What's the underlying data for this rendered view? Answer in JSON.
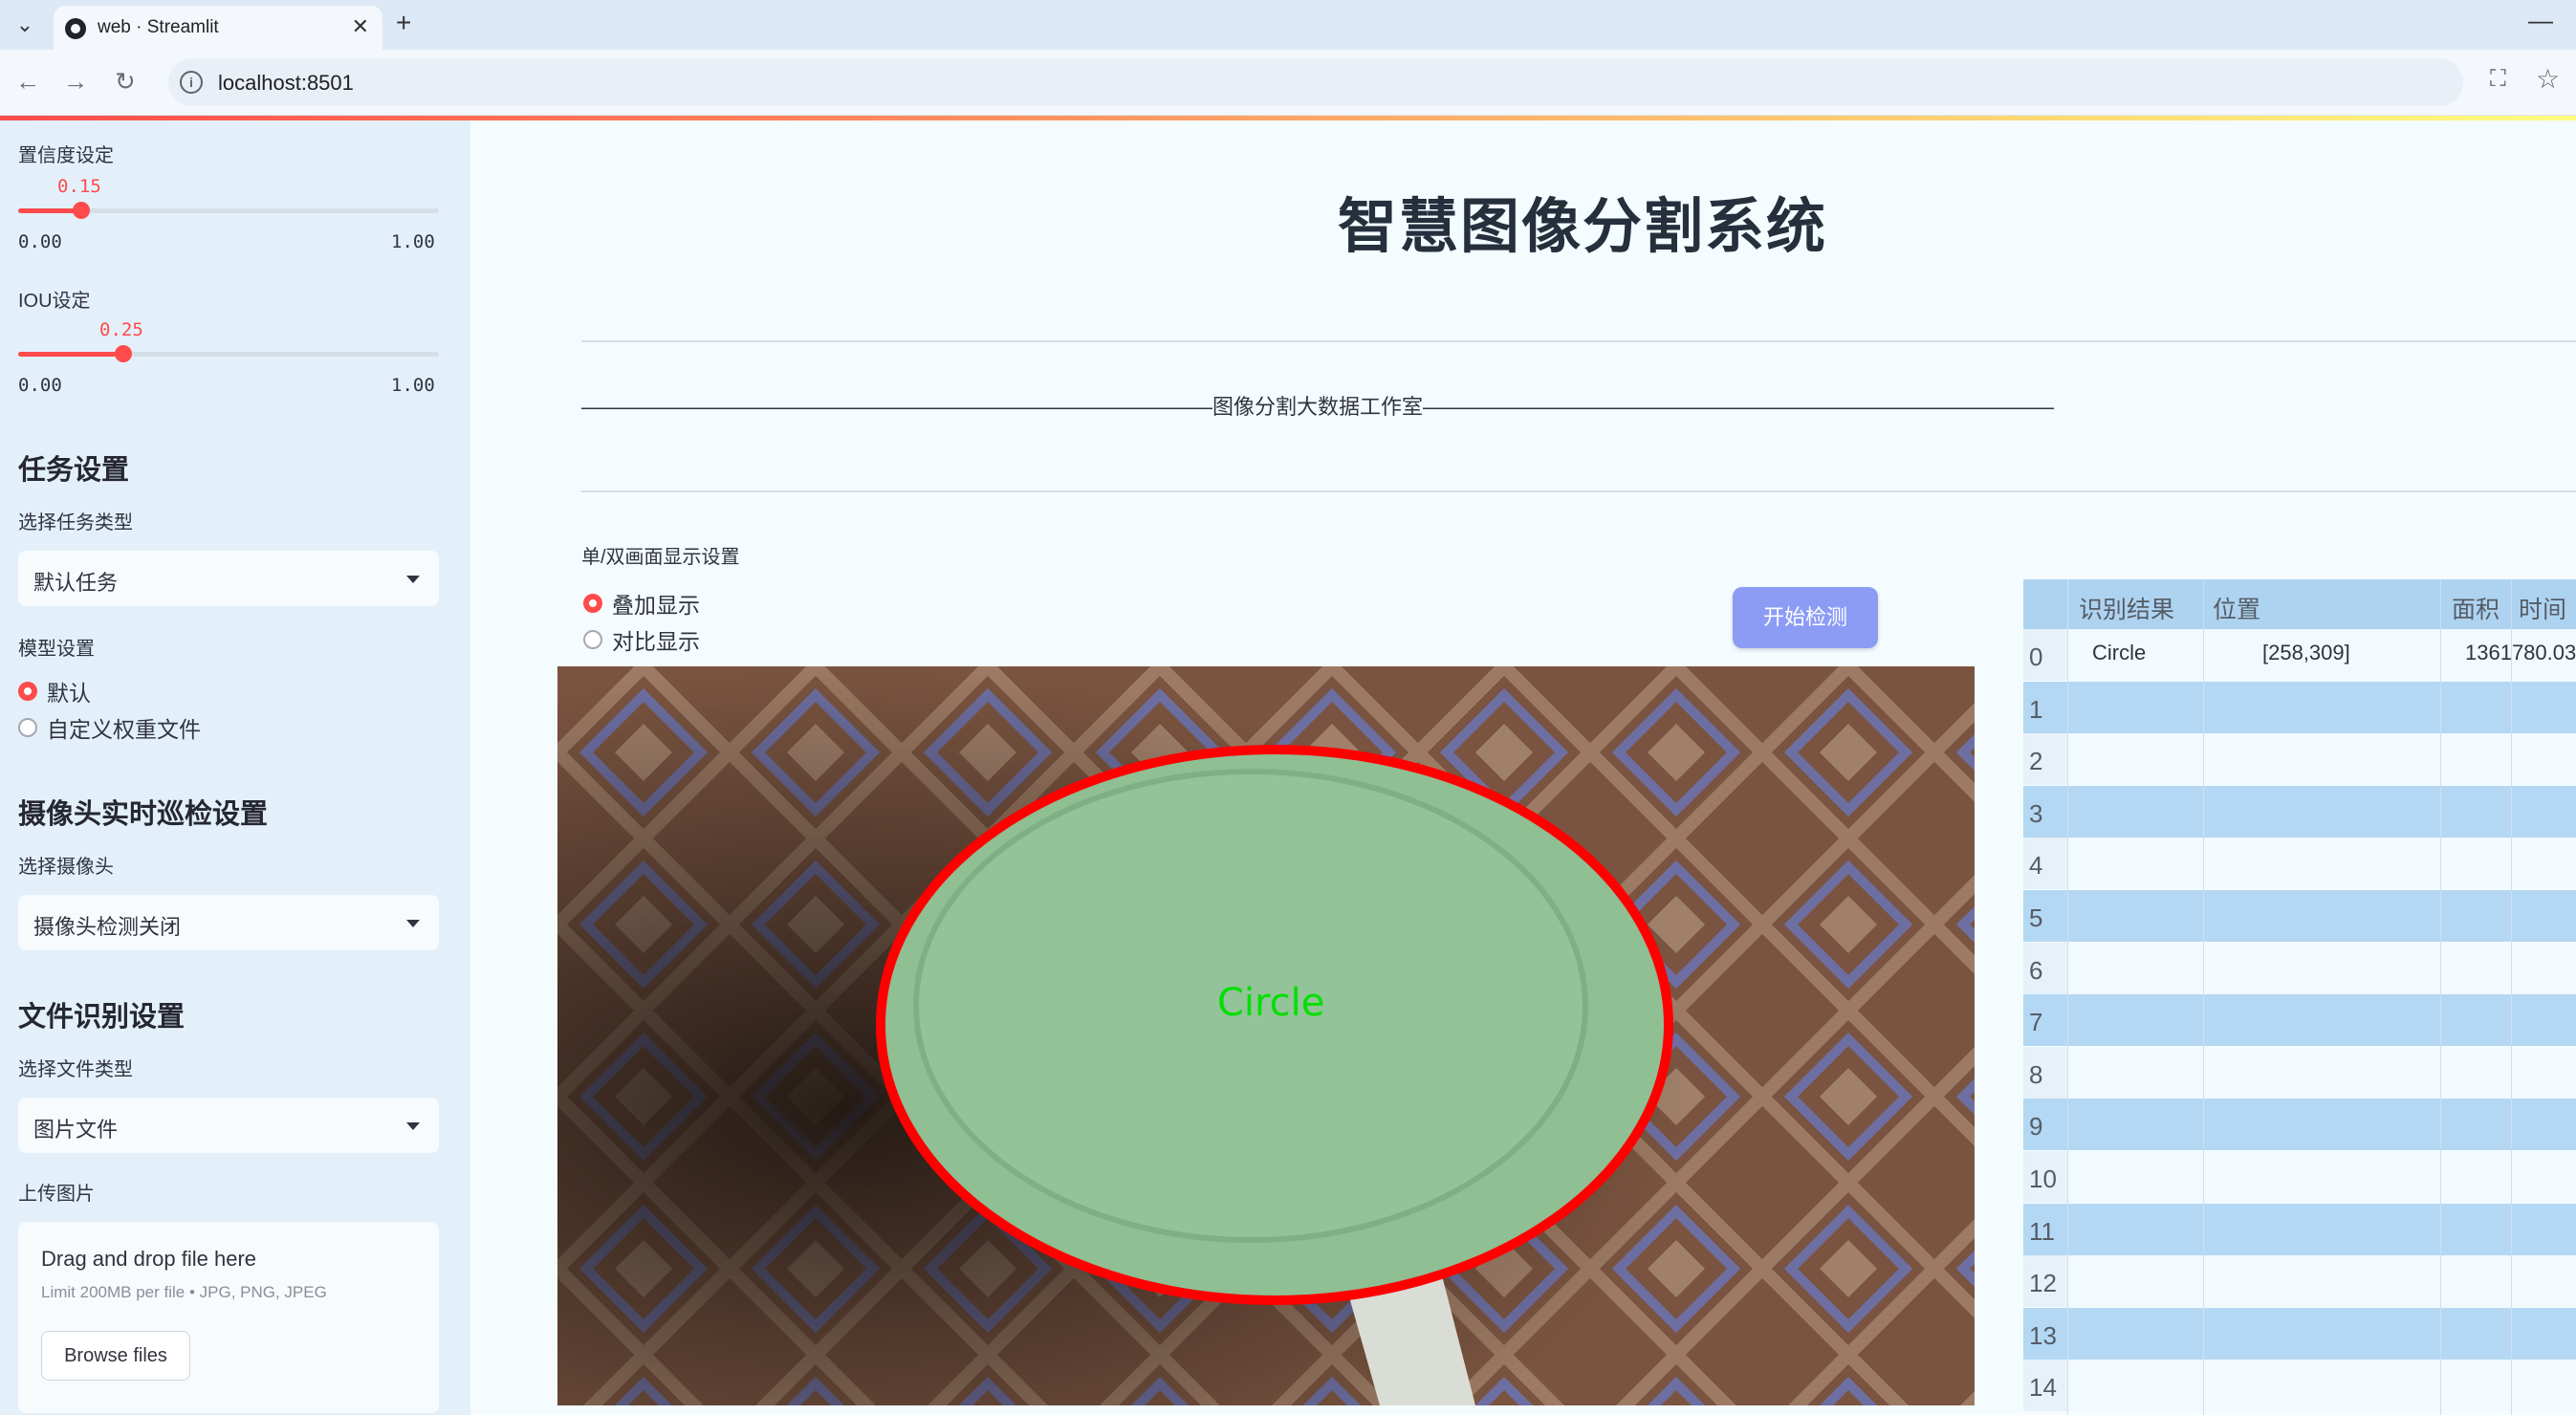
{
  "browser": {
    "tab_title": "web · Streamlit",
    "url": "localhost:8501"
  },
  "sidebar": {
    "confidence": {
      "label": "置信度设定",
      "value": "0.15",
      "value_fraction": 0.15,
      "min": "0.00",
      "max": "1.00"
    },
    "iou": {
      "label": "IOU设定",
      "value": "0.25",
      "value_fraction": 0.25,
      "min": "0.00",
      "max": "1.00"
    },
    "task_section": {
      "heading": "任务设置",
      "select_label": "选择任务类型",
      "select_value": "默认任务"
    },
    "model_section": {
      "label": "模型设置",
      "options": [
        "默认",
        "自定义权重文件"
      ],
      "selected": "默认"
    },
    "camera_section": {
      "heading": "摄像头实时巡检设置",
      "select_label": "选择摄像头",
      "select_value": "摄像头检测关闭"
    },
    "file_section": {
      "heading": "文件识别设置",
      "select_label": "选择文件类型",
      "select_value": "图片文件",
      "upload_label": "上传图片"
    },
    "uploader": {
      "title": "Drag and drop file here",
      "limit": "Limit 200MB per file • JPG, PNG, JPEG",
      "button": "Browse files"
    }
  },
  "main": {
    "title": "智慧图像分割系统",
    "subtitle": "——————————————————————————————图像分割大数据工作室——————————————————————————————",
    "display_label": "单/双画面显示设置",
    "display_options": [
      "叠加显示",
      "对比显示"
    ],
    "display_selected": "叠加显示",
    "start_button": "开始检测",
    "detection_label": "Circle"
  },
  "results_table": {
    "columns": [
      "识别结果",
      "位置",
      "面积",
      "时间"
    ],
    "rows": [
      {
        "index": "0",
        "result": "Circle",
        "position": "[258,309]",
        "area": "1361780.03",
        "time": ""
      },
      {
        "index": "1"
      },
      {
        "index": "2"
      },
      {
        "index": "3"
      },
      {
        "index": "4"
      },
      {
        "index": "5"
      },
      {
        "index": "6"
      },
      {
        "index": "7"
      },
      {
        "index": "8"
      },
      {
        "index": "9"
      },
      {
        "index": "10"
      },
      {
        "index": "11"
      },
      {
        "index": "12"
      },
      {
        "index": "13"
      },
      {
        "index": "14"
      }
    ]
  },
  "colors": {
    "accent": "#ff4b4b",
    "button": "#8c9cf5",
    "sidebar_bg": "#e3f0fa",
    "main_bg": "#f4fcff"
  }
}
